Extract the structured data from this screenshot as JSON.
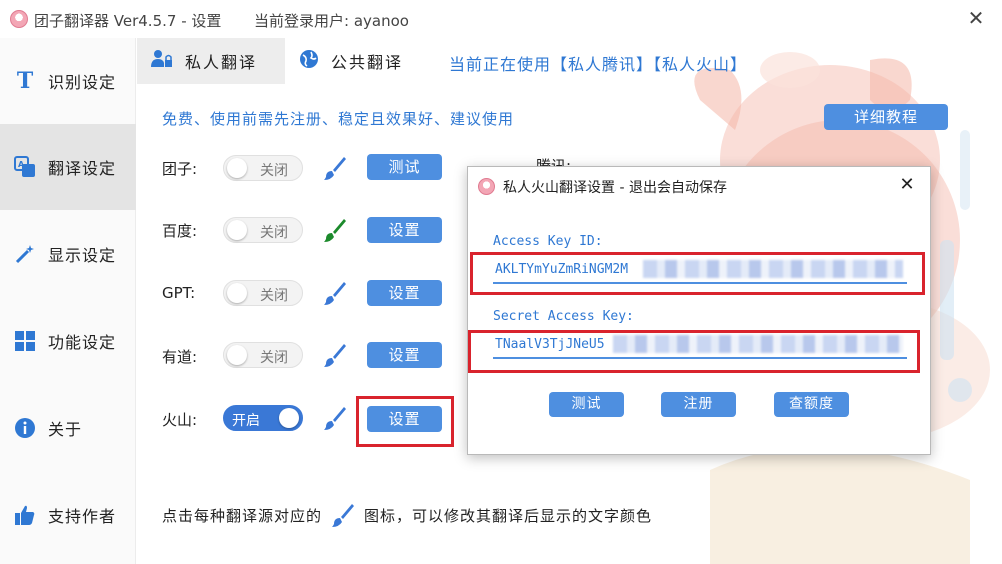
{
  "window": {
    "title": "团子翻译器 Ver4.5.7 - 设置",
    "login_info": "当前登录用户: ayanoo",
    "close_label": "✕"
  },
  "sidebar": {
    "items": [
      {
        "label": "识别设定",
        "icon": "text-recognition-icon",
        "active": false
      },
      {
        "label": "翻译设定",
        "icon": "translate-icon",
        "active": true
      },
      {
        "label": "显示设定",
        "icon": "magic-wand-icon",
        "active": false
      },
      {
        "label": "功能设定",
        "icon": "grid-icon",
        "active": false
      },
      {
        "label": "关于",
        "icon": "info-icon",
        "active": false
      },
      {
        "label": "支持作者",
        "icon": "thumbs-up-icon",
        "active": false
      }
    ]
  },
  "tabs": {
    "private": "私人翻译",
    "public": "公共翻译",
    "current_using": "当前正在使用【私人腾讯】【私人火山】"
  },
  "content": {
    "notice": "免费、使用前需先注册、稳定且效果好、建议使用",
    "tutorial_button": "详细教程",
    "rows": [
      {
        "label": "团子:",
        "toggle": "关闭",
        "state": "off",
        "button": "测试",
        "brush_color": "#3a78d6"
      },
      {
        "label": "百度:",
        "toggle": "关闭",
        "state": "off",
        "button": "设置",
        "brush_color": "#1c8a2c"
      },
      {
        "label": "GPT:",
        "toggle": "关闭",
        "state": "off",
        "button": "设置",
        "brush_color": "#3a78d6"
      },
      {
        "label": "有道:",
        "toggle": "关闭",
        "state": "off",
        "button": "设置",
        "brush_color": "#3a78d6"
      },
      {
        "label": "火山:",
        "toggle": "开启",
        "state": "on",
        "button": "设置",
        "brush_color": "#3a78d6"
      }
    ],
    "tencent": {
      "label": "腾讯:"
    },
    "footer_before": "点击每种翻译源对应的",
    "footer_after": "图标，可以修改其翻译后显示的文字颜色"
  },
  "dialog": {
    "title": "私人火山翻译设置 - 退出会自动保存",
    "close_label": "✕",
    "access_key_label": "Access Key ID:",
    "access_key_value": "AKLTYmYuZmRiNGM2M",
    "secret_key_label": "Secret Access Key:",
    "secret_key_value": "TNaalV3TjJNeU5",
    "buttons": {
      "test": "测试",
      "register": "注册",
      "quota": "查额度"
    }
  },
  "colors": {
    "accent": "#2f78d3",
    "button": "#4e8fe0",
    "highlight_red": "#d9232d"
  }
}
